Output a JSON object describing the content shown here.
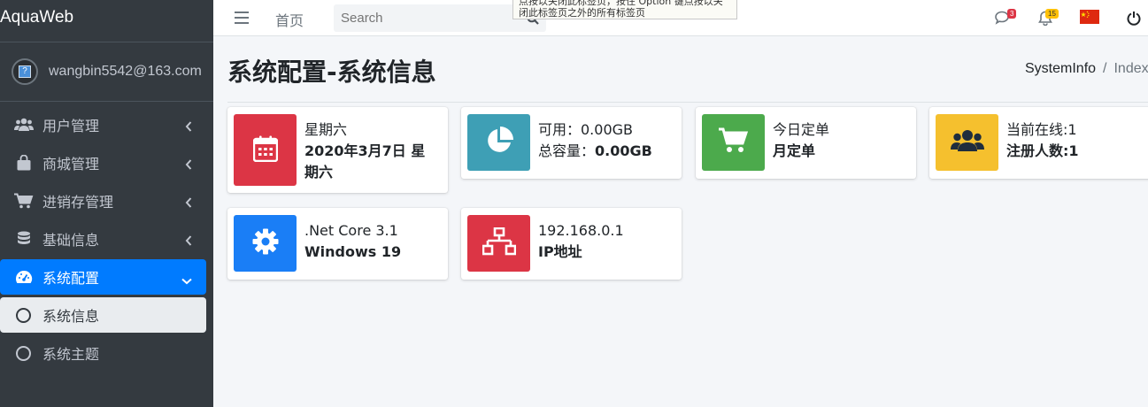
{
  "brand": "AquaWeb",
  "user": {
    "name": "wangbin5542@163.com"
  },
  "sidebar": {
    "items": [
      {
        "label": "用户管理",
        "icon": "users-icon"
      },
      {
        "label": "商城管理",
        "icon": "shopping-bag-icon"
      },
      {
        "label": "进销存管理",
        "icon": "cart-icon"
      },
      {
        "label": "基础信息",
        "icon": "database-icon"
      },
      {
        "label": "系统配置",
        "icon": "dashboard-icon"
      }
    ],
    "subitems": [
      {
        "label": "系统信息"
      },
      {
        "label": "系统主题"
      }
    ]
  },
  "topbar": {
    "home": "首页",
    "search_placeholder": "Search",
    "tooltip": "点按以关闭此标签页，按住 Option 键点按以关闭此标签页之外的所有标签页",
    "messages_badge": "3",
    "notifications_badge": "15"
  },
  "page": {
    "title": "系统配置-系统信息",
    "breadcrumb": [
      "SystemInfo",
      "Index"
    ]
  },
  "cards": [
    {
      "line1": "星期六",
      "line2": "2020年3月7日 星期六",
      "icon": "calendar-icon",
      "color": "#dc3545"
    },
    {
      "line1": "可用：0.00GB",
      "line2_label": "总容量：",
      "line2_value": "0.00GB",
      "icon": "pie-chart-icon",
      "color": "#3e9fb5"
    },
    {
      "line1": "今日定单",
      "line2": "月定单",
      "icon": "cart-icon",
      "color": "#4caa4c"
    },
    {
      "line1": "当前在线:1",
      "line2": "注册人数:1",
      "icon": "users-icon",
      "color": "#f5c02e"
    },
    {
      "line1": ".Net Core 3.1",
      "line2": "Windows 19",
      "icon": "gear-icon",
      "color": "#1a7ef6"
    },
    {
      "line1": "192.168.0.1",
      "line2": "IP地址",
      "icon": "network-icon",
      "color": "#dc3545"
    }
  ]
}
